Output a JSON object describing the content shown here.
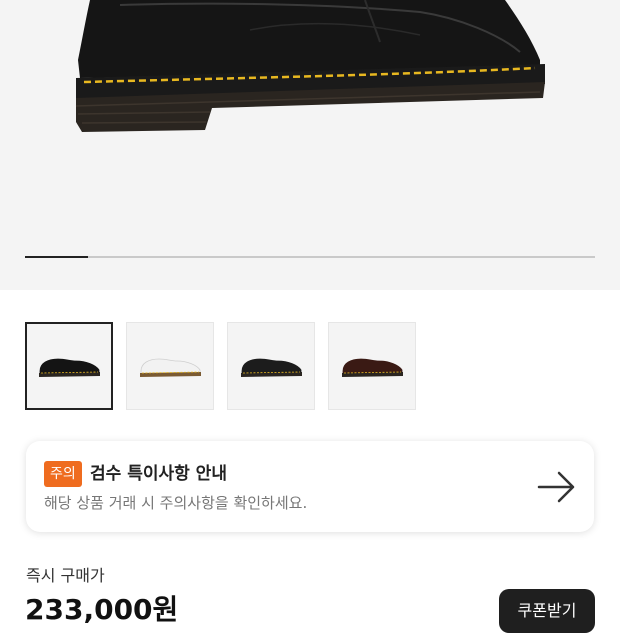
{
  "gallery": {
    "progress_fraction": 0.11,
    "thumbnails": [
      {
        "name": "black-shoe",
        "color": "#141414",
        "selected": true
      },
      {
        "name": "white-shoe",
        "color": "#f2f2f2",
        "selected": false
      },
      {
        "name": "black-yellow-stitch-shoe",
        "color": "#1c1c1c",
        "selected": false
      },
      {
        "name": "burgundy-shoe",
        "color": "#3a1a14",
        "selected": false
      }
    ]
  },
  "notice": {
    "badge": "주의",
    "title": "검수 특이사항 안내",
    "description": "해당 상품 거래 시 주의사항을 확인하세요.",
    "arrow_icon": "arrow-right-icon"
  },
  "price": {
    "label": "즉시 구매가",
    "value": "233,000원"
  },
  "coupon_button": {
    "label": "쿠폰받기"
  },
  "colors": {
    "badge": "#ef6c1f",
    "hero_bg": "#f4f4f4",
    "button_bg": "#1f1f1f"
  }
}
